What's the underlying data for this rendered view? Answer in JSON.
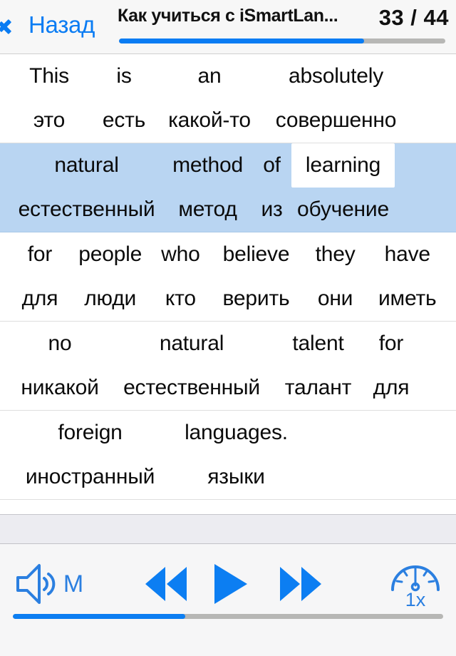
{
  "header": {
    "back_label": "Назад",
    "title": "Как учиться с iSmartLan...",
    "counter": "33 / 44",
    "progress_percent": 75,
    "accent_color": "#0a7cf3",
    "track_color": "#b7b7b5"
  },
  "content": {
    "rows": [
      {
        "active": false,
        "source": [
          "This",
          "is",
          "an",
          "absolutely"
        ],
        "target": [
          "это",
          "есть",
          "какой-то",
          "совершенно"
        ],
        "widths": [
          110,
          100,
          140,
          215
        ],
        "current_index": -1
      },
      {
        "active": true,
        "source": [
          "natural",
          "method",
          "of",
          "learning"
        ],
        "target": [
          "естественный",
          "метод",
          "из",
          "обучение"
        ],
        "widths": [
          215,
          125,
          55,
          145
        ],
        "current_index": 3
      },
      {
        "active": false,
        "source": [
          "for",
          "people",
          "who",
          "believe",
          "they",
          "have"
        ],
        "target": [
          "для",
          "люди",
          "кто",
          "верить",
          "они",
          "иметь"
        ],
        "widths": [
          85,
          115,
          85,
          130,
          95,
          110
        ],
        "current_index": -1
      },
      {
        "active": false,
        "source": [
          "no",
          "natural",
          "talent",
          "for"
        ],
        "target": [
          "никакой",
          "естественный",
          "талант",
          "для"
        ],
        "widths": [
          140,
          230,
          125,
          80
        ],
        "current_index": -1
      },
      {
        "active": false,
        "source": [
          "foreign",
          "languages."
        ],
        "target": [
          "иностранный",
          "языки"
        ],
        "widths": [
          225,
          185
        ],
        "current_index": -1
      }
    ],
    "highlight_color": "#b9d5f2",
    "current_word_bg": "#ffffff"
  },
  "toolbar": {
    "speaker_letter": "M",
    "speaker_icon": "speaker-wave-icon",
    "rewind_icon": "rewind-icon",
    "play_icon": "play-icon",
    "forward_icon": "fast-forward-icon",
    "speed_icon": "speedometer-icon",
    "speed_label": "1x",
    "progress_percent": 40,
    "accent_color": "#0c7ef2",
    "track_color": "#b7b7b5"
  }
}
